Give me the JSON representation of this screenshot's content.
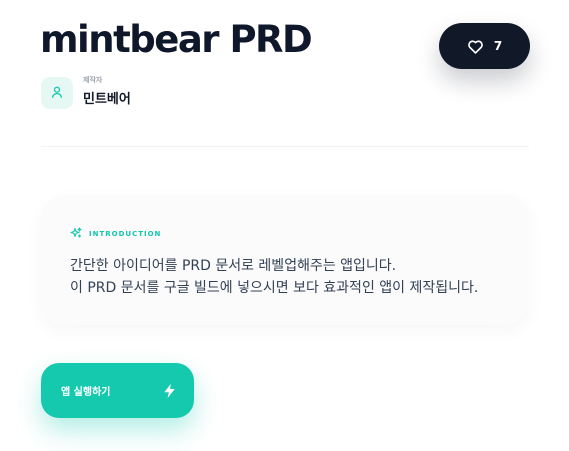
{
  "header": {
    "title": "mintbear PRD",
    "like_count": "7",
    "like_icon": "heart-icon"
  },
  "creator": {
    "caption": "제작자",
    "name": "민트베어",
    "avatar_icon": "user-icon"
  },
  "intro": {
    "label": "INTRODUCTION",
    "icon": "sparkle-icon",
    "lines": [
      "간단한 아이디어를 PRD 문서로 레벨업해주는 앱입니다.",
      "이 PRD 문서를 구글 빌드에 넣으시면 보다 효과적인 앱이 제작됩니다."
    ]
  },
  "action": {
    "run_label": "앱 실행하기",
    "run_icon": "lightning-icon"
  },
  "colors": {
    "accent": "#14c9ad",
    "dark": "#111827",
    "text": "#334155"
  }
}
